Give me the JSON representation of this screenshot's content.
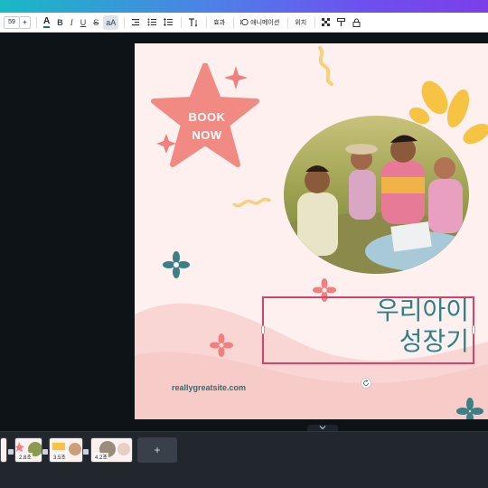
{
  "toolbar": {
    "font_size": "59",
    "plus": "+",
    "text_color_glyph": "A",
    "bold": "B",
    "italic": "I",
    "underline": "U",
    "strike": "S",
    "case": "aA",
    "effects": "효과",
    "animate": "애니메이션",
    "position": "위치"
  },
  "design": {
    "book_line1": "BOOK",
    "book_line2": "NOW",
    "heading_line1": "우리아이",
    "heading_line2": "성장기",
    "website": "reallygreatsite.com"
  },
  "pages": [
    {
      "label": ""
    },
    {
      "label": "2.8초"
    },
    {
      "label": "3.5초"
    },
    {
      "label": "4.2초"
    }
  ],
  "add_page": "+",
  "colors": {
    "accent_pink": "#f07f7f",
    "teal_text": "#2f7f88",
    "yellow": "#f6c343",
    "selection": "#d2446b"
  }
}
